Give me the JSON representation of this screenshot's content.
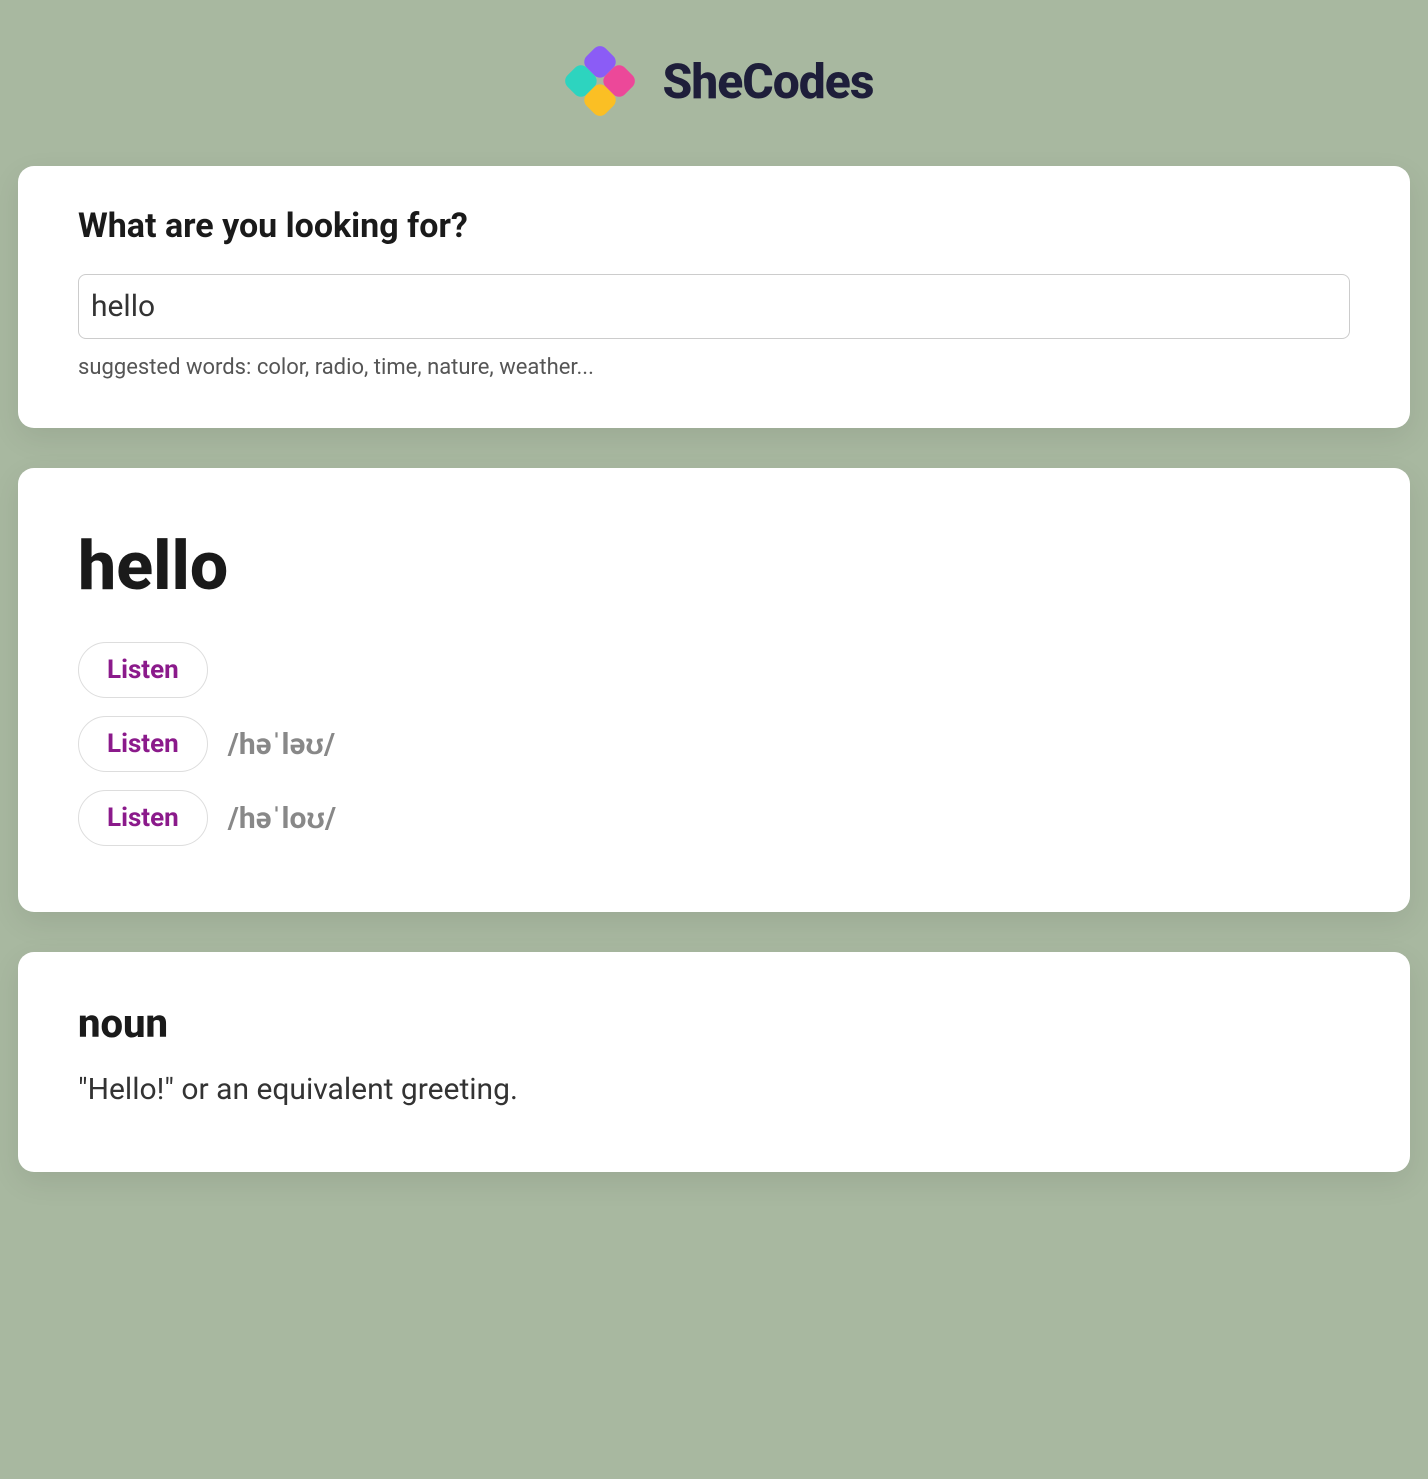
{
  "brand": {
    "name": "SheCodes"
  },
  "search": {
    "heading": "What are you looking for?",
    "value": "hello",
    "suggested": "suggested words: color, radio, time, nature, weather..."
  },
  "result": {
    "word": "hello",
    "phonetics": [
      {
        "label": "Listen",
        "text": ""
      },
      {
        "label": "Listen",
        "text": "/həˈləʊ/"
      },
      {
        "label": "Listen",
        "text": "/həˈloʊ/"
      }
    ]
  },
  "definition": {
    "part_of_speech": "noun",
    "text": "\"Hello!\" or an equivalent greeting."
  }
}
